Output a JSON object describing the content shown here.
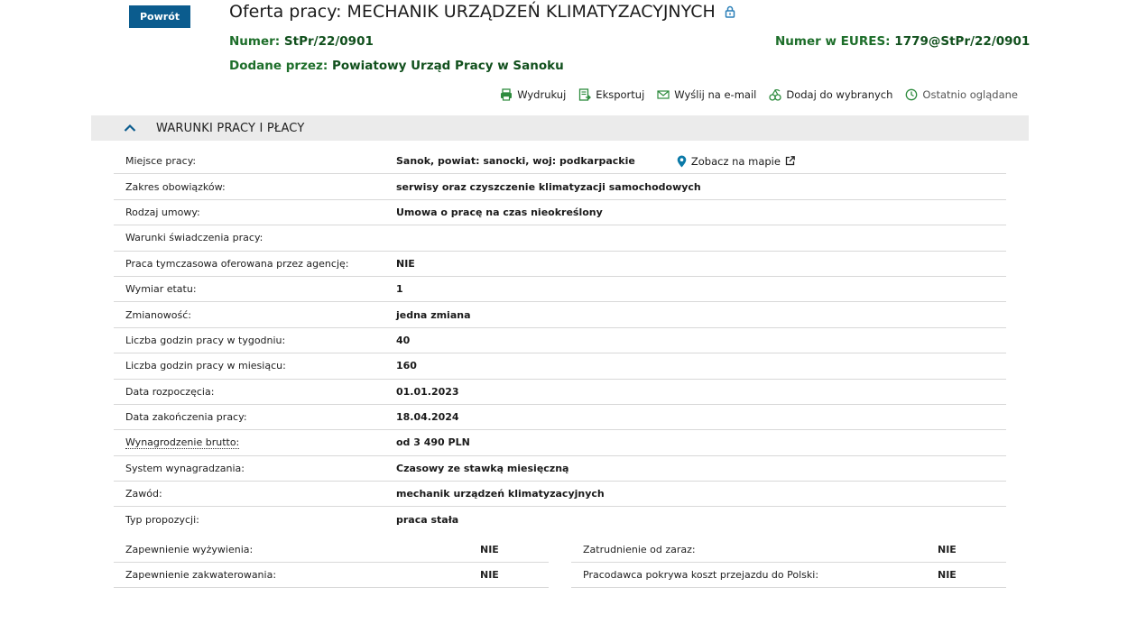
{
  "header": {
    "back_label": "Powrót",
    "title": "Oferta pracy: MECHANIK URZĄDZEŃ KLIMATYZACYJNYCH",
    "numer_key": "Numer:",
    "numer_value": "StPr/22/0901",
    "eures_key": "Numer w EURES:",
    "eures_value": "1779@StPr/22/0901",
    "added_key": "Dodane przez:",
    "added_value": "Powiatowy Urząd Pracy w Sanoku"
  },
  "actions": {
    "print": "Wydrukuj",
    "export": "Eksportuj",
    "email": "Wyślij na e-mail",
    "favorite": "Dodaj do wybranych",
    "recent": "Ostatnio oglądane"
  },
  "section": {
    "title": "WARUNKI PRACY I PŁACY",
    "map_link": "Zobacz na mapie"
  },
  "rows": [
    {
      "label": "Miejsce pracy:",
      "value": "Sanok, powiat: sanocki, woj: podkarpackie"
    },
    {
      "label": "Zakres obowiązków:",
      "value": "serwisy oraz czyszczenie klimatyzacji samochodowych"
    },
    {
      "label": "Rodzaj umowy:",
      "value": "Umowa o pracę na czas nieokreślony"
    },
    {
      "label": "Warunki świadczenia pracy:",
      "value": ""
    },
    {
      "label": "Praca tymczasowa oferowana przez agencję:",
      "value": "NIE"
    },
    {
      "label": "Wymiar etatu:",
      "value": "1"
    },
    {
      "label": "Zmianowość:",
      "value": "jedna zmiana"
    },
    {
      "label": "Liczba godzin pracy w tygodniu:",
      "value": "40"
    },
    {
      "label": "Liczba godzin pracy w miesiącu:",
      "value": "160"
    },
    {
      "label": "Data rozpoczęcia:",
      "value": "01.01.2023"
    },
    {
      "label": "Data zakończenia pracy:",
      "value": "18.04.2024"
    },
    {
      "label": "Wynagrodzenie brutto:",
      "value": "od 3 490 PLN"
    },
    {
      "label": "System wynagradzania:",
      "value": "Czasowy ze stawką miesięczną"
    },
    {
      "label": "Zawód:",
      "value": "mechanik urządzeń klimatyzacyjnych"
    },
    {
      "label": "Typ propozycji:",
      "value": "praca stała"
    }
  ],
  "half_rows": {
    "food_label": "Zapewnienie wyżywienia:",
    "food_value": "NIE",
    "housing_label": "Zapewnienie zakwaterowania:",
    "housing_value": "NIE",
    "immediate_label": "Zatrudnienie od zaraz:",
    "immediate_value": "NIE",
    "travel_label": "Pracodawca pokrywa koszt przejazdu do Polski:",
    "travel_value": "NIE"
  }
}
